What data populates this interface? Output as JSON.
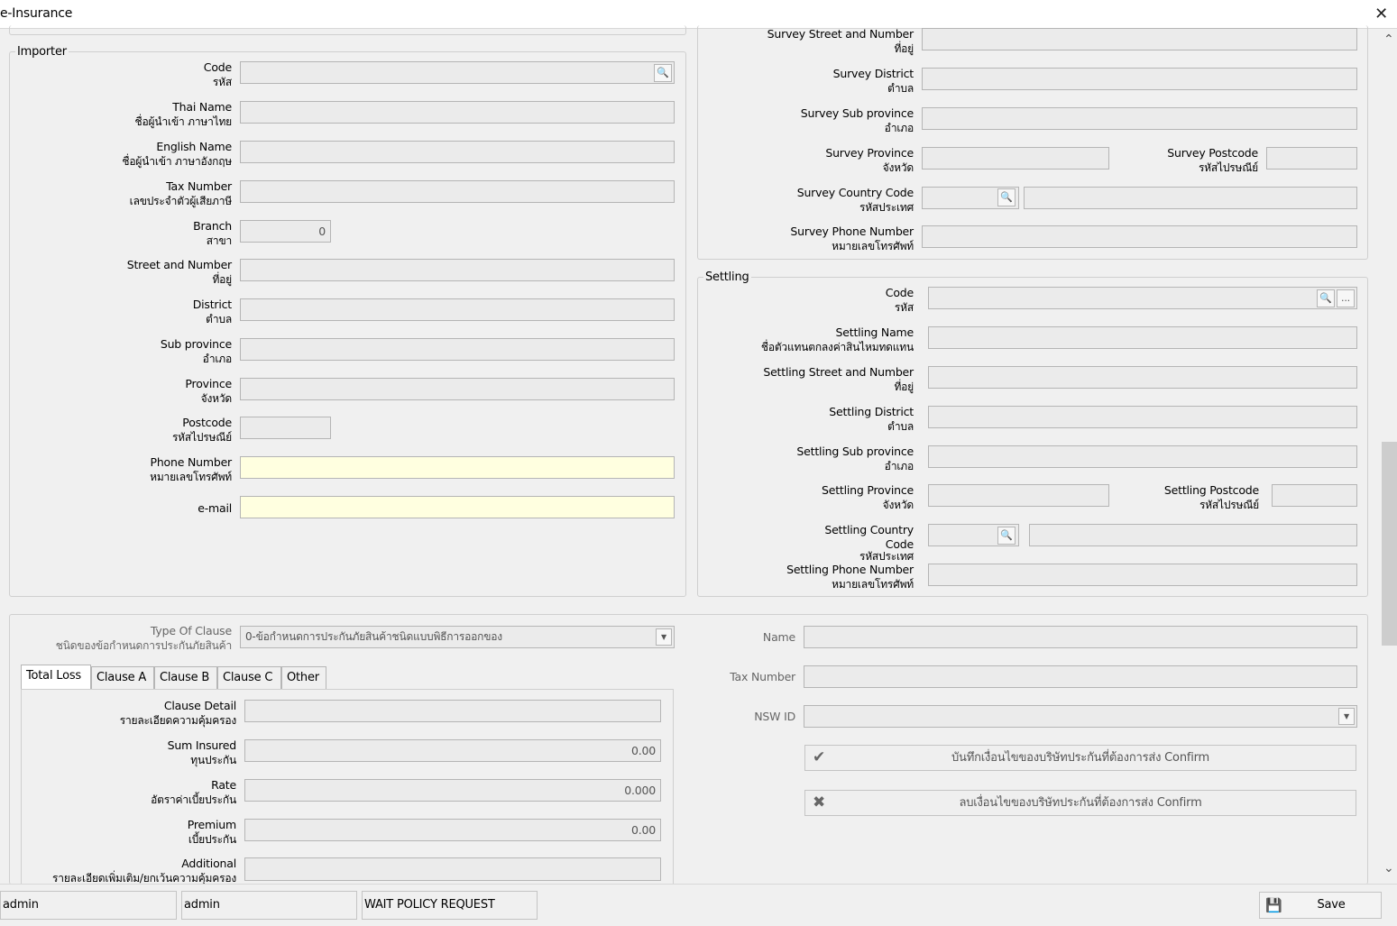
{
  "window": {
    "title": "e-Insurance",
    "close_glyph": "✕"
  },
  "importer": {
    "legend": "Importer",
    "fields": {
      "code": {
        "en": "Code",
        "th": "รหัส",
        "value": ""
      },
      "thai_name": {
        "en": "Thai Name",
        "th": "ชื่อผู้นำเข้า ภาษาไทย",
        "value": ""
      },
      "english_name": {
        "en": "English Name",
        "th": "ชื่อผู้นำเข้า ภาษาอังกฤษ",
        "value": ""
      },
      "tax_number": {
        "en": "Tax Number",
        "th": "เลขประจำตัวผู้เสียภาษี",
        "value": ""
      },
      "branch": {
        "en": "Branch",
        "th": "สาขา",
        "value": "0"
      },
      "street": {
        "en": "Street and Number",
        "th": "ที่อยู่",
        "value": ""
      },
      "district": {
        "en": "District",
        "th": "ตำบล",
        "value": ""
      },
      "sub_province": {
        "en": "Sub province",
        "th": "อำเภอ",
        "value": ""
      },
      "province": {
        "en": "Province",
        "th": "จังหวัด",
        "value": ""
      },
      "postcode": {
        "en": "Postcode",
        "th": "รหัสไปรษณีย์",
        "value": ""
      },
      "phone": {
        "en": "Phone Number",
        "th": "หมายเลขโทรศัพท์",
        "value": ""
      },
      "email": {
        "en": "e-mail",
        "value": ""
      }
    }
  },
  "survey": {
    "street": {
      "en": "Survey Street and Number",
      "th": "ที่อยู่",
      "value": ""
    },
    "district": {
      "en": "Survey District",
      "th": "ตำบล",
      "value": ""
    },
    "sub_province": {
      "en": "Survey Sub province",
      "th": "อำเภอ",
      "value": ""
    },
    "province": {
      "en": "Survey Province",
      "th": "จังหวัด",
      "value": ""
    },
    "postcode": {
      "en": "Survey Postcode",
      "th": "รหัสไปรษณีย์",
      "value": ""
    },
    "country_code": {
      "en": "Survey Country Code",
      "th": "รหัสประเทศ",
      "value": "",
      "name_value": ""
    },
    "phone": {
      "en": "Survey Phone Number",
      "th": "หมายเลขโทรศัพท์",
      "value": ""
    }
  },
  "settling": {
    "legend": "Settling",
    "code": {
      "en": "Code",
      "th": "รหัส",
      "value": ""
    },
    "name": {
      "en": "Settling Name",
      "th": "ชื่อตัวแทนตกลงค่าสินไหมทดแทน",
      "value": ""
    },
    "street": {
      "en": "Settling Street and Number",
      "th": "ที่อยู่",
      "value": ""
    },
    "district": {
      "en": "Settling District",
      "th": "ตำบล",
      "value": ""
    },
    "sub_province": {
      "en": "Settling Sub province",
      "th": "อำเภอ",
      "value": ""
    },
    "province": {
      "en": "Settling Province",
      "th": "จังหวัด",
      "value": ""
    },
    "postcode": {
      "en": "Settling Postcode",
      "th": "รหัสไปรษณีย์",
      "value": ""
    },
    "country_code": {
      "en1": "Settling Country",
      "en2": "Code",
      "th": "รหัสประเทศ",
      "value": "",
      "name_value": ""
    },
    "phone": {
      "en": "Settling Phone Number",
      "th": "หมายเลขโทรศัพท์",
      "value": ""
    }
  },
  "clause": {
    "type": {
      "en": "Type Of Clause",
      "th": "ชนิดของข้อกำหนดการประกันภัยสินค้า",
      "value": "0-ข้อกำหนดการประกันภัยสินค้าชนิดแบบพิธีการออกของ"
    },
    "tabs": [
      "Total Loss",
      "Clause A",
      "Clause B",
      "Clause C",
      "Other"
    ],
    "active_tab": "Total Loss",
    "detail": {
      "en": "Clause Detail",
      "th": "รายละเอียดความคุ้มครอง",
      "value": ""
    },
    "sum_insured": {
      "en": "Sum Insured",
      "th": "ทุนประกัน",
      "value": "0.00"
    },
    "rate": {
      "en": "Rate",
      "th": "อัตราค่าเบี้ยประกัน",
      "value": "0.000"
    },
    "premium": {
      "en": "Premium",
      "th": "เบี้ยประกัน",
      "value": "0.00"
    },
    "additional": {
      "en": "Additional",
      "th": "รายละเอียดเพิ่มเติม/ยกเว้นความคุ้มครอง",
      "value": ""
    }
  },
  "insurer": {
    "name_label": "Name",
    "name_value": "",
    "tax_label": "Tax Number",
    "tax_value": "",
    "nsw_label": "NSW ID",
    "nsw_value": "",
    "confirm_button": "บันทึกเงื่อนไขของบริษัทประกันที่ต้องการส่ง Confirm",
    "delete_button": "ลบเงื่อนไขของบริษัทประกันที่ต้องการส่ง Confirm"
  },
  "statusbar": {
    "user1": "admin",
    "user2": "admin",
    "status": "WAIT POLICY REQUEST",
    "save_label": "Save"
  },
  "icons": {
    "search": "🔍",
    "more": "...",
    "dropdown": "▼",
    "check": "✔",
    "cross": "✖",
    "save": "💾",
    "scroll_up": "⌃",
    "scroll_down": "⌄"
  }
}
